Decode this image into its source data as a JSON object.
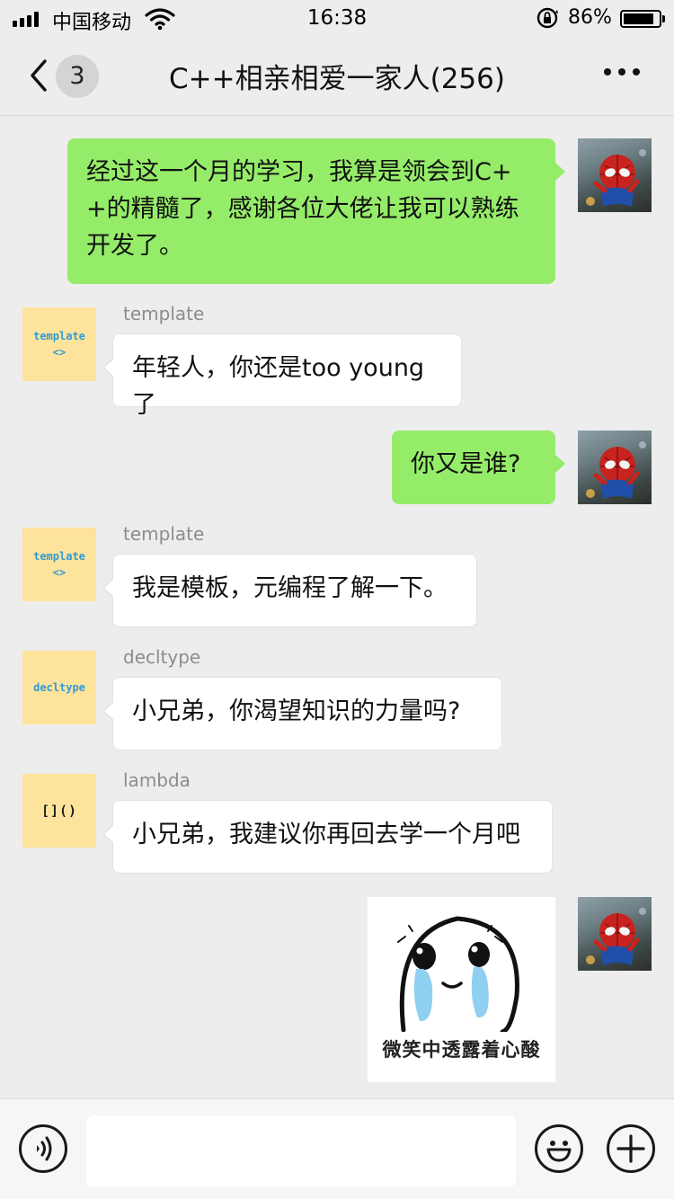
{
  "status_bar": {
    "carrier": "中国移动",
    "time": "16:38",
    "battery_percent": "86%",
    "battery_level": 0.86
  },
  "header": {
    "unread_count": "3",
    "title": "C++相亲相爱一家人(256)"
  },
  "messages": [
    {
      "from": "me",
      "text": "经过这一个月的学习，我算是领会到C+\n+的精髓了，感谢各位大佬让我可以熟练\n开发了。"
    },
    {
      "from": "template",
      "sender": "template",
      "avatar_line1": "template",
      "avatar_line2": "<>",
      "text": "年轻人，你还是too young了"
    },
    {
      "from": "me",
      "text": "你又是谁?"
    },
    {
      "from": "template",
      "sender": "template",
      "avatar_line1": "template",
      "avatar_line2": "<>",
      "text": "我是模板，元编程了解一下。"
    },
    {
      "from": "decltype",
      "sender": "decltype",
      "avatar_line1": "decltype",
      "text": "小兄弟，你渴望知识的力量吗?"
    },
    {
      "from": "lambda",
      "sender": "lambda",
      "avatar_line1": "[]()",
      "text": "小兄弟，我建议你再回去学一个月吧"
    },
    {
      "from": "me",
      "sticker_caption": "微笑中透露着心酸"
    }
  ],
  "input_bar": {
    "voice_icon": "voice-icon",
    "emoji_icon": "emoji-icon",
    "plus_icon": "plus-icon"
  },
  "colors": {
    "my_bubble": "#95ec69",
    "other_bubble": "#ffffff",
    "code_avatar_bg": "#fde39c",
    "background": "#ededed"
  }
}
